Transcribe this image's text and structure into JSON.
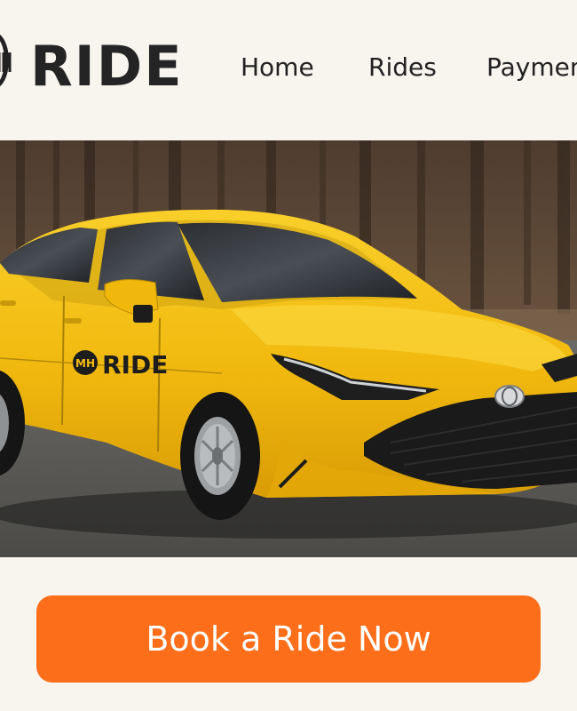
{
  "brand": {
    "name": "RIDE",
    "icon": "mh-logo-icon",
    "car_decal_text": "RIDE",
    "car_decal_monogram": "MH"
  },
  "nav": {
    "items": [
      {
        "label": "Home"
      },
      {
        "label": "Rides"
      },
      {
        "label": "Payments"
      }
    ]
  },
  "hero": {
    "image_subject": "yellow taxi sedan",
    "car_badge": "Toyota"
  },
  "cta": {
    "label": "Book a Ride Now"
  },
  "colors": {
    "background": "#f8f4ee",
    "accent": "#fd6e1a",
    "taxi_yellow": "#f4be12",
    "text": "#222222"
  }
}
